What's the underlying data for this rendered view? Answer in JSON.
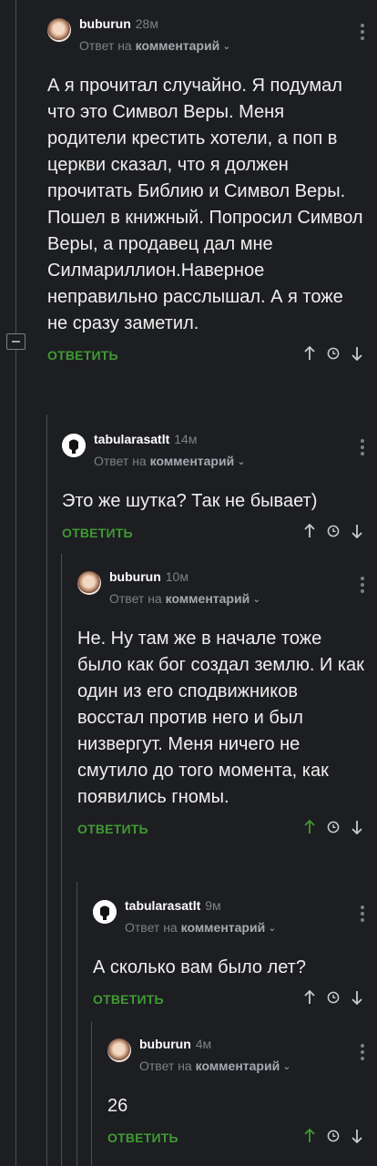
{
  "comments": [
    {
      "username": "buburun",
      "time": "28м",
      "reply_prefix": "Ответ на",
      "reply_target": "комментарий",
      "text": "А я прочитал случайно. Я подумал что это Символ Веры. Меня родители крестить хотели, а поп в церкви сказал, что я должен прочитать Библию и Символ Веры. Пошел в книжный. Попросил Символ Веры, а продавец дал мне Силмариллион.Наверное неправильно расслышал. А я тоже не сразу заметил.",
      "reply_label": "ОТВЕТИТЬ",
      "avatar": "face",
      "upvoted": false
    },
    {
      "username": "tabularasatlt",
      "time": "14м",
      "reply_prefix": "Ответ на",
      "reply_target": "комментарий",
      "text": "Это же шутка? Так не бывает)",
      "reply_label": "ОТВЕТИТЬ",
      "avatar": "logo",
      "upvoted": false
    },
    {
      "username": "buburun",
      "time": "10м",
      "reply_prefix": "Ответ на",
      "reply_target": "комментарий",
      "text": "Не. Ну там же в начале тоже было как бог создал землю. И как один из его сподвижников восстал против него и был низвергут. Меня ничего не смутило до того момента, как появились гномы.",
      "reply_label": "ОТВЕТИТЬ",
      "avatar": "face",
      "upvoted": true
    },
    {
      "username": "tabularasatlt",
      "time": "9м",
      "reply_prefix": "Ответ на",
      "reply_target": "комментарий",
      "text": "А сколько вам было лет?",
      "reply_label": "ОТВЕТИТЬ",
      "avatar": "logo",
      "upvoted": false
    },
    {
      "username": "buburun",
      "time": "4м",
      "reply_prefix": "Ответ на",
      "reply_target": "комментарий",
      "text": "26",
      "reply_label": "ОТВЕТИТЬ",
      "avatar": "face",
      "upvoted": true
    }
  ],
  "colors": {
    "background": "#1d1e21",
    "reply_green": "#3f9a33",
    "muted": "#7d8087"
  },
  "icons": [
    "collapse-icon",
    "more-icon",
    "upvote-icon",
    "history-icon",
    "downvote-icon"
  ]
}
